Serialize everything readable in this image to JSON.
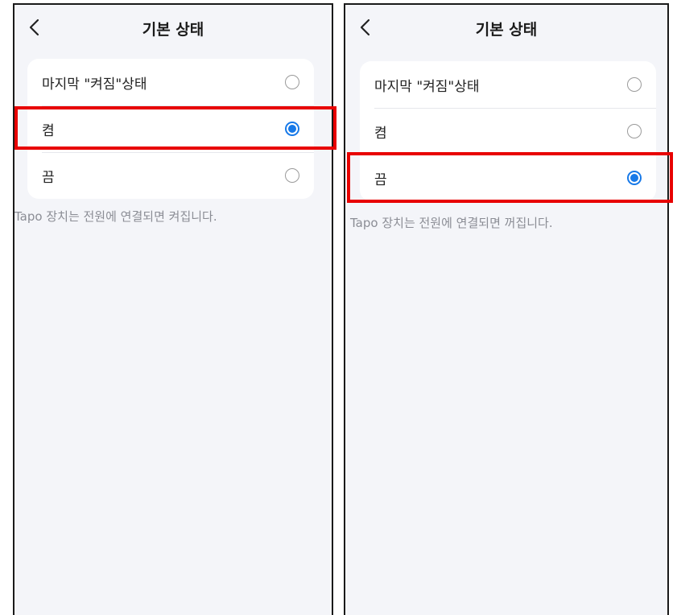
{
  "panels": [
    {
      "header": {
        "title": "기본 상태"
      },
      "options": [
        {
          "label": "마지막 \"켜짐\"상태",
          "selected": false
        },
        {
          "label": "켬",
          "selected": true
        },
        {
          "label": "끔",
          "selected": false
        }
      ],
      "note": "Tapo 장치는 전원에 연결되면 켜집니다."
    },
    {
      "header": {
        "title": "기본 상태"
      },
      "options": [
        {
          "label": "마지막 \"켜짐\"상태",
          "selected": false
        },
        {
          "label": "켬",
          "selected": false
        },
        {
          "label": "끔",
          "selected": true
        }
      ],
      "note": "Tapo 장치는 전원에 연결되면 꺼집니다."
    }
  ],
  "colors": {
    "accent": "#1779e8",
    "highlight": "#e80000",
    "background": "#f4f5f9"
  }
}
